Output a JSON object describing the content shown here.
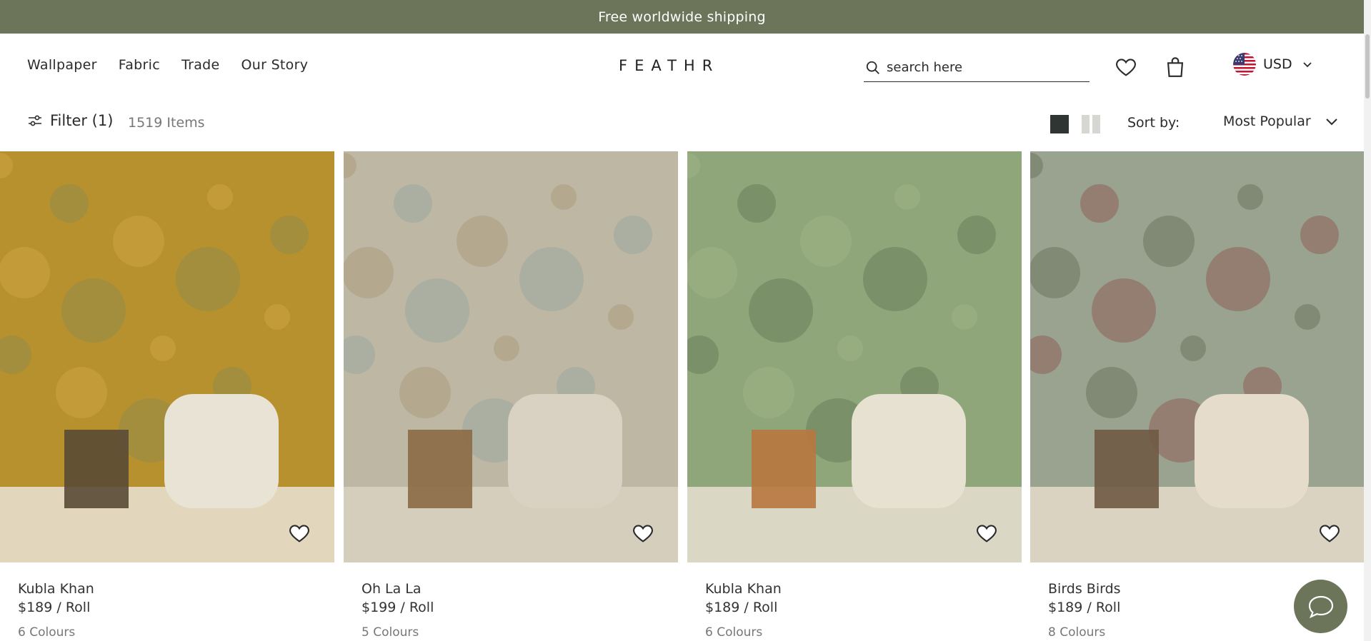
{
  "colors": {
    "brand": "#6c7459",
    "chat": "#6c7459",
    "text": "#2b2b2b",
    "muted": "#777777"
  },
  "announcement": "Free worldwide shipping",
  "nav": [
    "Wallpaper",
    "Fabric",
    "Trade",
    "Our Story"
  ],
  "logo": "FEATHR",
  "search": {
    "placeholder": "search here",
    "icon": "search-icon"
  },
  "header_icons": [
    "heart-icon",
    "bag-icon"
  ],
  "currency": {
    "label": "USD",
    "flag": "us-flag-icon"
  },
  "toolbar": {
    "filter_label": "Filter (1)",
    "item_count": "1519 Items",
    "sort_label": "Sort by:",
    "sort_value": "Most Popular",
    "view_modes": [
      "single-view-icon",
      "double-view-icon"
    ]
  },
  "products": [
    {
      "name": "Kubla Khan",
      "price": "$189 / Roll",
      "colours": "6 Colours",
      "palette": [
        "#b8912f",
        "#d7b04a",
        "#7a8a5a",
        "#e9e3d6",
        "#5a4a35"
      ]
    },
    {
      "name": "Oh La La",
      "price": "$199 / Roll",
      "colours": "5 Colours",
      "palette": [
        "#bdb7a4",
        "#a38c6a",
        "#8aa0a0",
        "#d9d2c2",
        "#8b6a45"
      ]
    },
    {
      "name": "Kubla Khan",
      "price": "$189 / Roll",
      "colours": "6 Colours",
      "palette": [
        "#8ea67a",
        "#a9b98d",
        "#55664a",
        "#e7e1d1",
        "#b8773f"
      ]
    },
    {
      "name": "Birds Birds",
      "price": "$189 / Roll",
      "colours": "8 Colours",
      "palette": [
        "#9aa290",
        "#4f5e45",
        "#8a3d3d",
        "#e5dccb",
        "#6f5a44"
      ]
    }
  ]
}
